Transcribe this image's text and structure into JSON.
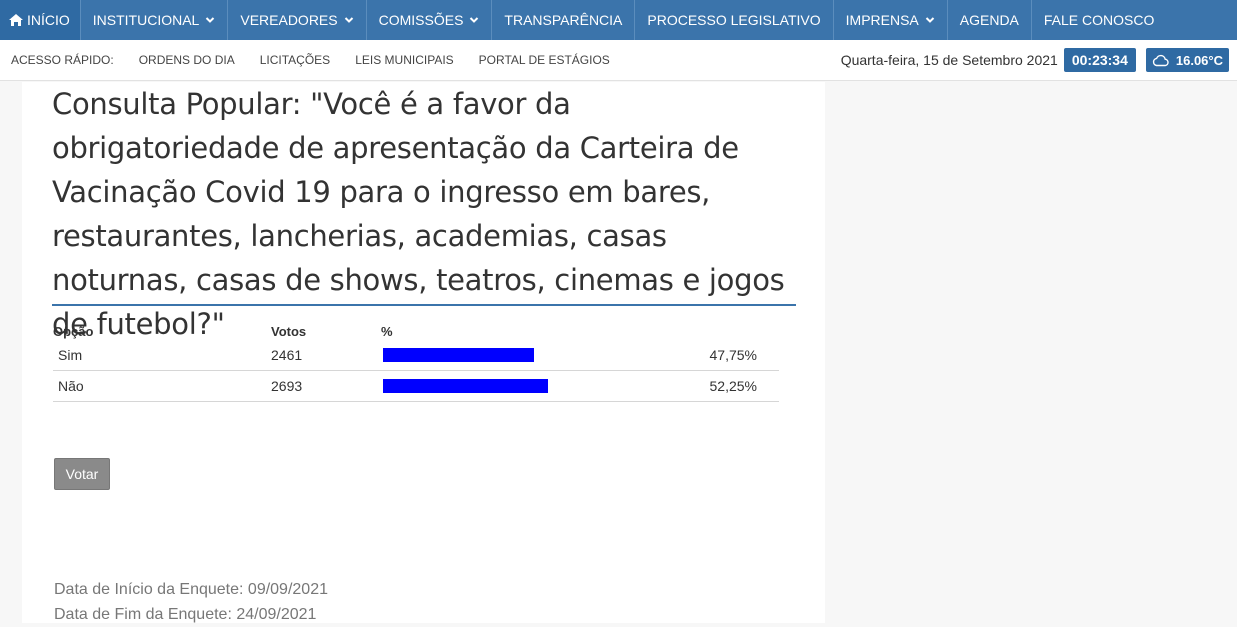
{
  "nav": {
    "items": [
      {
        "label": "Início",
        "icon": "home-icon"
      },
      {
        "label": "Institucional",
        "dropdown": true
      },
      {
        "label": "Vereadores",
        "dropdown": true
      },
      {
        "label": "Comissões",
        "dropdown": true
      },
      {
        "label": "Transparência",
        "dropdown": false
      },
      {
        "label": "Processo Legislativo",
        "dropdown": false
      },
      {
        "label": "Imprensa",
        "dropdown": true
      },
      {
        "label": "Agenda",
        "dropdown": false
      },
      {
        "label": "Fale Conosco",
        "dropdown": false
      }
    ],
    "bg_color": "#3b74ab"
  },
  "quick": {
    "label": "Acesso Rápido:",
    "links": [
      "Ordens do Dia",
      "Licitações",
      "Leis Municipais",
      "Portal de Estágios"
    ],
    "date": "Quarta-feira, 15 de Setembro 2021",
    "time": "00:23:34",
    "temperature": "16.06°C",
    "weather_icon": "cloud-icon"
  },
  "poll": {
    "title": "Consulta Popular: \"Você é a favor da obrigatoriedade de apresentação da Carteira de Vacinação Covid 19 para o ingresso em bares, restaurantes, lancherias, academias, casas noturnas, casas de shows, teatros, cinemas e jogos de futebol?\"",
    "headers": {
      "option": "Opção",
      "votes": "Votos",
      "percent": "%"
    },
    "rows": [
      {
        "option": "Sim",
        "votes": "2461",
        "percent": "47,75%",
        "bar_fraction": 0.4775
      },
      {
        "option": "Não",
        "votes": "2693",
        "percent": "52,25%",
        "bar_fraction": 0.5225
      }
    ],
    "bar_color": "#0000ff",
    "vote_button": "Votar",
    "start_date": "Data de Início da Enquete: 09/09/2021",
    "end_date": "Data de Fim da Enquete: 24/09/2021"
  }
}
